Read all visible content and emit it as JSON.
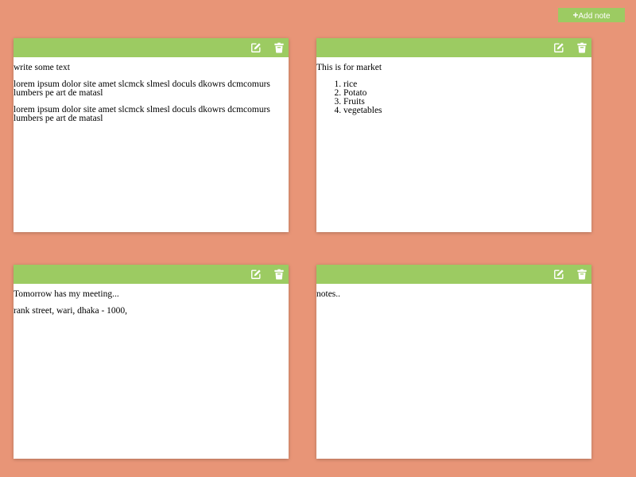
{
  "toolbar": {
    "add_note_icon": "plus-icon",
    "add_note_label": "Add note",
    "add_note_color": "#9ccb62"
  },
  "colors": {
    "background": "#e89577",
    "note_header": "#9ccb62",
    "note_body": "#ffffff"
  },
  "notes": [
    {
      "icons": [
        "edit-icon",
        "trash-icon"
      ],
      "paragraphs": [
        "write some text",
        "lorem ipsum dolor site amet slcmck slmesl doculs dkowrs dcmcomurs lumbers pe art de matasl",
        "lorem ipsum dolor site amet slcmck slmesl doculs dkowrs dcmcomurs lumbers pe art de matasl"
      ]
    },
    {
      "icons": [
        "edit-icon",
        "trash-icon"
      ],
      "paragraphs": [
        "This is for market"
      ],
      "list": [
        "rice",
        "Potato",
        "Fruits",
        "vegetables"
      ]
    },
    {
      "icons": [
        "edit-icon",
        "trash-icon"
      ],
      "paragraphs": [
        "Tomorrow has my meeting...",
        "rank street, wari, dhaka - 1000,"
      ]
    },
    {
      "icons": [
        "edit-icon",
        "trash-icon"
      ],
      "paragraphs": [
        "notes.."
      ]
    }
  ]
}
